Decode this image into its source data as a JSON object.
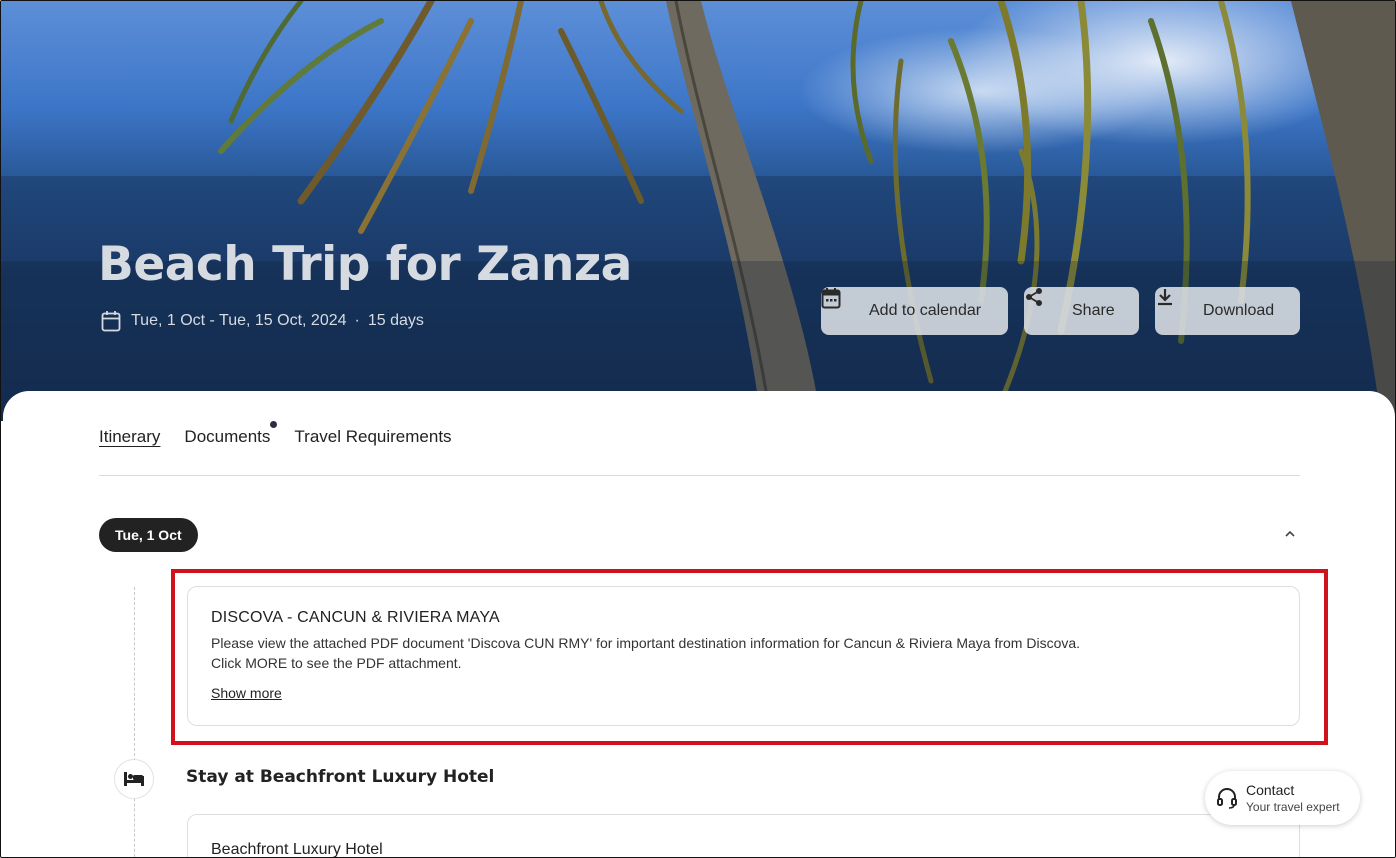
{
  "hero": {
    "title": "Beach Trip for Zanza",
    "date_range": "Tue, 1 Oct - Tue, 15 Oct, 2024",
    "separator": "·",
    "duration": "15 days",
    "buttons": {
      "add_to_calendar": "Add to calendar",
      "share": "Share",
      "download": "Download"
    },
    "icons": {
      "calendar": "calendar-icon",
      "share": "share-icon",
      "download": "download-icon"
    }
  },
  "tabs": [
    {
      "label": "Itinerary",
      "active": true
    },
    {
      "label": "Documents",
      "has_notification_dot": true
    },
    {
      "label": "Travel Requirements"
    }
  ],
  "day": {
    "label": "Tue, 1 Oct",
    "note": {
      "title": "DISCOVA - CANCUN & RIVIERA MAYA",
      "line1": "Please view the attached PDF document 'Discova CUN RMY' for important destination information for Cancun & Riviera Maya from Discova.",
      "line2": "Click MORE to see the PDF attachment.",
      "show_more": "Show more"
    },
    "stay": {
      "title": "Stay at Beachfront Luxury Hotel",
      "hotel_name": "Beachfront Luxury Hotel"
    }
  },
  "contact": {
    "title": "Contact",
    "subtitle": "Your travel expert"
  },
  "colors": {
    "highlight": "#d0131b",
    "pill_bg": "#222222",
    "hero_button_bg": "#dce0e6"
  }
}
